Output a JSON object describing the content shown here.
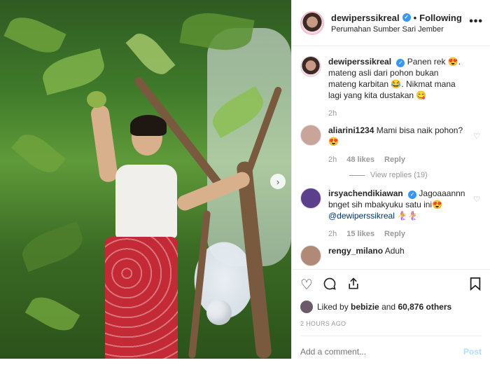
{
  "header": {
    "username": "dewiperssikreal",
    "follow_status": "Following",
    "location": "Perumahan Sumber Sari Jember"
  },
  "caption": {
    "username": "dewiperssikreal",
    "text": "Panen rek 😍. mateng asli dari pohon bukan mateng karbitan 😂. Nikmat mana lagi yang kita dustakan 😋",
    "time": "2h"
  },
  "comments": [
    {
      "username": "aliarini1234",
      "text": "Mami bisa naik pohon?😍",
      "time": "2h",
      "likes": "48 likes",
      "reply": "Reply",
      "view_replies": "View replies (19)"
    },
    {
      "username": "irsyachendikiawan",
      "text": "Jagoaaannn bnget sih mbakyuku satu ini😍",
      "mention": "@dewiperssikreal",
      "emoji": "🧜‍♀️🧜‍♀️",
      "time": "2h",
      "likes": "15 likes",
      "reply": "Reply"
    },
    {
      "username": "rengy_milano",
      "text": "Aduh"
    }
  ],
  "actions": {
    "liked_by_prefix": "Liked by",
    "liked_by_user": "bebizie",
    "liked_by_and": "and",
    "liked_by_others": "60,876 others",
    "time_ago": "2 HOURS AGO"
  },
  "comment_box": {
    "placeholder": "Add a comment...",
    "post_label": "Post"
  },
  "icons": {
    "verified": "verified-badge-icon",
    "more": "more-options-icon",
    "like": "heart-icon",
    "comment": "comment-icon",
    "share": "share-icon",
    "save": "bookmark-icon",
    "next": "chevron-right-icon"
  },
  "colors": {
    "verified_blue": "#3897f0",
    "link_blue": "#003569",
    "post_button": "#b2dffc"
  }
}
